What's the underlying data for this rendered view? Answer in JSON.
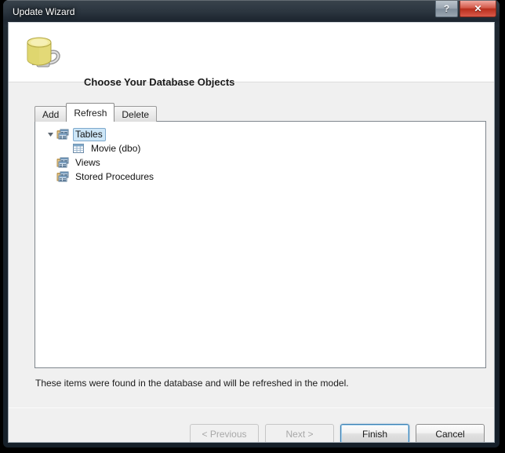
{
  "window": {
    "title": "Update Wizard",
    "caption_buttons": [
      {
        "name": "help-button",
        "glyph": "?"
      },
      {
        "name": "close-button",
        "glyph": "✕"
      }
    ]
  },
  "header": {
    "icon": "database-plug-icon",
    "heading": "Choose Your Database Objects"
  },
  "tabs": [
    {
      "label": "Add",
      "selected": false
    },
    {
      "label": "Refresh",
      "selected": true
    },
    {
      "label": "Delete",
      "selected": false
    }
  ],
  "tree": {
    "nodes": [
      {
        "label": "Tables",
        "icon": "tables-folder-icon",
        "indent": 0,
        "expanded": true,
        "selected": true,
        "has_twisty": true
      },
      {
        "label": "Movie (dbo)",
        "icon": "table-grid-icon",
        "indent": 1,
        "expanded": false,
        "selected": false,
        "has_twisty": false
      },
      {
        "label": "Views",
        "icon": "views-folder-icon",
        "indent": 0,
        "expanded": false,
        "selected": false,
        "has_twisty": false
      },
      {
        "label": "Stored Procedures",
        "icon": "stored-procedures-folder-icon",
        "indent": 0,
        "expanded": false,
        "selected": false,
        "has_twisty": false
      }
    ]
  },
  "status": {
    "message": "These items were found in the database and will be refreshed in the model."
  },
  "footer": {
    "buttons": [
      {
        "label": "< Previous",
        "state": "disabled"
      },
      {
        "label": "Next >",
        "state": "disabled"
      },
      {
        "label": "Finish",
        "state": "default"
      },
      {
        "label": "Cancel",
        "state": "normal"
      }
    ]
  },
  "colors": {
    "accent_focus": "#3c7fb1",
    "selection": "#cde6f7",
    "close_button": "#b72e1c",
    "client_bg": "#f0f0f0"
  }
}
